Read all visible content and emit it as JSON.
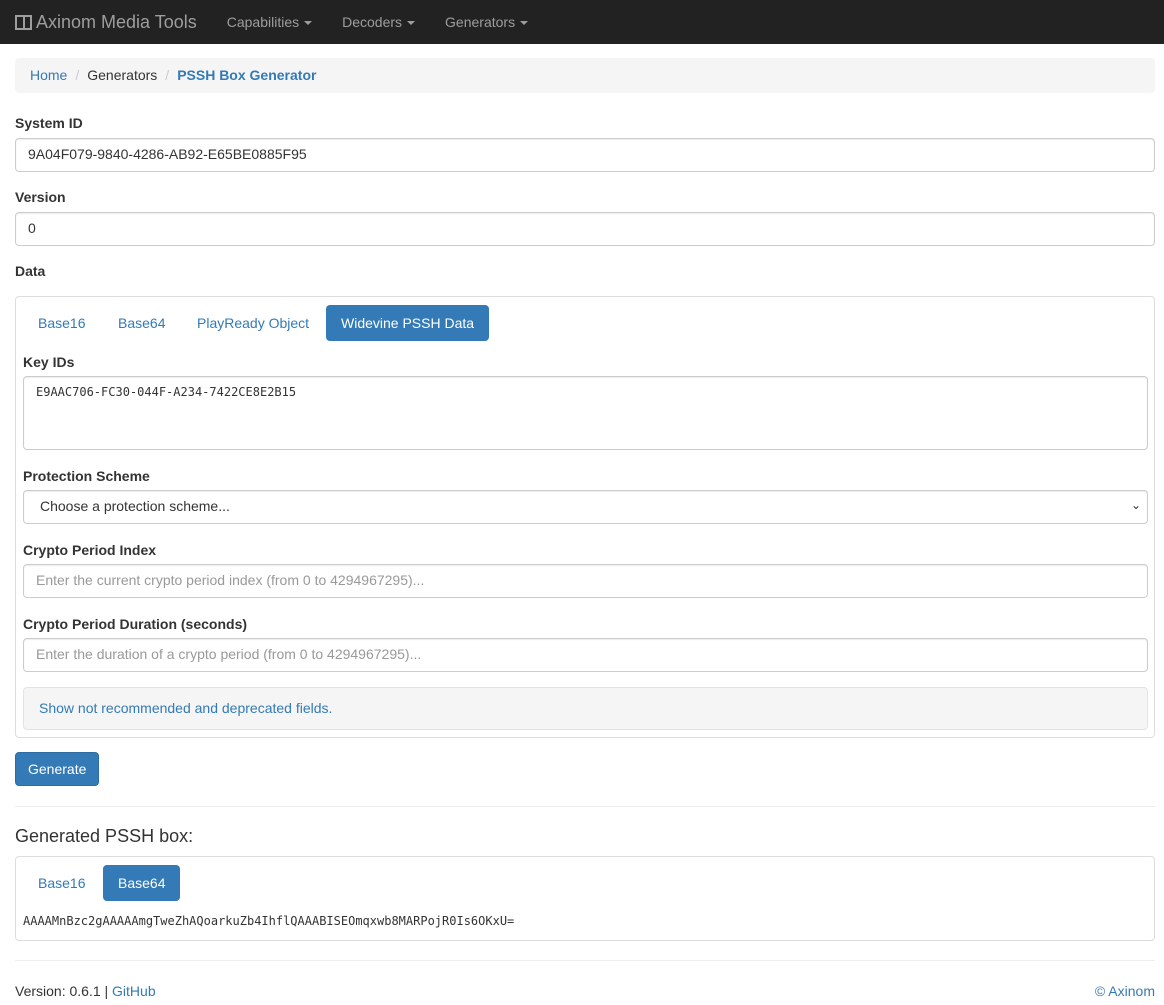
{
  "nav": {
    "brand": "Axinom Media Tools",
    "items": [
      "Capabilities",
      "Decoders",
      "Generators"
    ]
  },
  "breadcrumb": [
    "Home",
    "Generators",
    "PSSH Box Generator"
  ],
  "form": {
    "system_id_label": "System ID",
    "system_id": "9A04F079-9840-4286-AB92-E65BE0885F95",
    "version_label": "Version",
    "version": "0",
    "data_label": "Data",
    "tabs": [
      "Base16",
      "Base64",
      "PlayReady Object",
      "Widevine PSSH Data"
    ],
    "key_ids_label": "Key IDs",
    "key_ids": "E9AAC706-FC30-044F-A234-7422CE8E2B15",
    "protection_label": "Protection Scheme",
    "protection_value": "Choose a protection scheme...",
    "cpi_label": "Crypto Period Index",
    "cpi_placeholder": "Enter the current crypto period index (from 0 to 4294967295)...",
    "cpd_label": "Crypto Period Duration (seconds)",
    "cpd_placeholder": "Enter the duration of a crypto period (from 0 to 4294967295)...",
    "show_deprecated": "Show not recommended and deprecated fields.",
    "generate": "Generate"
  },
  "result": {
    "heading": "Generated PSSH box:",
    "tabs": [
      "Base16",
      "Base64"
    ],
    "value": "AAAAMnBzc2gAAAAAmgTweZhAQoarkuZb4IhflQAAABISEOmqxwb8MARPojR0Is6OKxU="
  },
  "footer": {
    "version": "Version: 0.6.1 |",
    "github": "GitHub",
    "copyright": "© Axinom"
  }
}
